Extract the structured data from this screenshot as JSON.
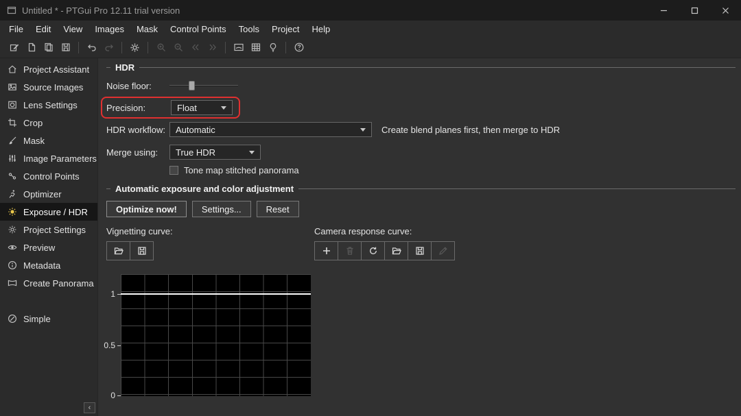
{
  "window": {
    "title": "Untitled * - PTGui Pro 12.11 trial version",
    "controls": [
      "minimize",
      "maximize",
      "close"
    ]
  },
  "menu": {
    "items": [
      "File",
      "Edit",
      "View",
      "Images",
      "Mask",
      "Control Points",
      "Tools",
      "Project",
      "Help"
    ]
  },
  "toolbar": {
    "icons": [
      "edit",
      "new-page",
      "copy-pages",
      "save",
      "undo",
      "redo",
      "settings-gear",
      "zoom-in",
      "zoom-out",
      "previous-image",
      "next-image",
      "panorama-editor",
      "detail-grid",
      "lightbulb",
      "help"
    ]
  },
  "sidebar": {
    "items": [
      {
        "label": "Project Assistant",
        "icon": "home"
      },
      {
        "label": "Source Images",
        "icon": "image"
      },
      {
        "label": "Lens Settings",
        "icon": "lens"
      },
      {
        "label": "Crop",
        "icon": "crop"
      },
      {
        "label": "Mask",
        "icon": "brush"
      },
      {
        "label": "Image Parameters",
        "icon": "sliders"
      },
      {
        "label": "Control Points",
        "icon": "points"
      },
      {
        "label": "Optimizer",
        "icon": "runner"
      },
      {
        "label": "Exposure / HDR",
        "icon": "sun",
        "selected": true
      },
      {
        "label": "Project Settings",
        "icon": "gear"
      },
      {
        "label": "Preview",
        "icon": "eye"
      },
      {
        "label": "Metadata",
        "icon": "info"
      },
      {
        "label": "Create Panorama",
        "icon": "panorama"
      }
    ],
    "simple": "Simple",
    "collapse": "‹"
  },
  "hdr": {
    "section_title": "HDR",
    "noise_floor_label": "Noise floor:",
    "precision_label": "Precision:",
    "precision_value": "Float",
    "workflow_label": "HDR workflow:",
    "workflow_value": "Automatic",
    "workflow_hint": "Create blend planes first, then merge to HDR",
    "merge_label": "Merge using:",
    "merge_value": "True HDR",
    "tone_map_label": "Tone map stitched panorama",
    "tone_map_checked": false
  },
  "adjust": {
    "section_title": "Automatic exposure and color adjustment",
    "optimize_button": "Optimize now!",
    "settings_button": "Settings...",
    "reset_button": "Reset",
    "vignetting_label": "Vignetting curve:",
    "vignetting_icons": [
      "open-folder",
      "save"
    ],
    "camera_response_label": "Camera response curve:",
    "camera_response_icons": [
      "add",
      "delete",
      "reload",
      "open-folder",
      "save",
      "edit-pencil"
    ],
    "camera_response_disabled": [
      "delete",
      "edit-pencil"
    ]
  },
  "chart_data": {
    "type": "line",
    "title": "",
    "y_ticks": [
      "1",
      "0.5",
      "0"
    ],
    "y_tick_values": [
      1,
      0.5,
      0
    ],
    "y_range_shown": [
      0,
      1.18
    ],
    "series": [
      {
        "name": "curve",
        "x": [
          0,
          1
        ],
        "values": [
          1,
          1
        ]
      }
    ],
    "grid": true,
    "plot_background": "#000000",
    "line_color": "#ffffff"
  },
  "colors": {
    "annotation_red": "#e03030",
    "selected_icon_yellow": "#e8c64a"
  }
}
